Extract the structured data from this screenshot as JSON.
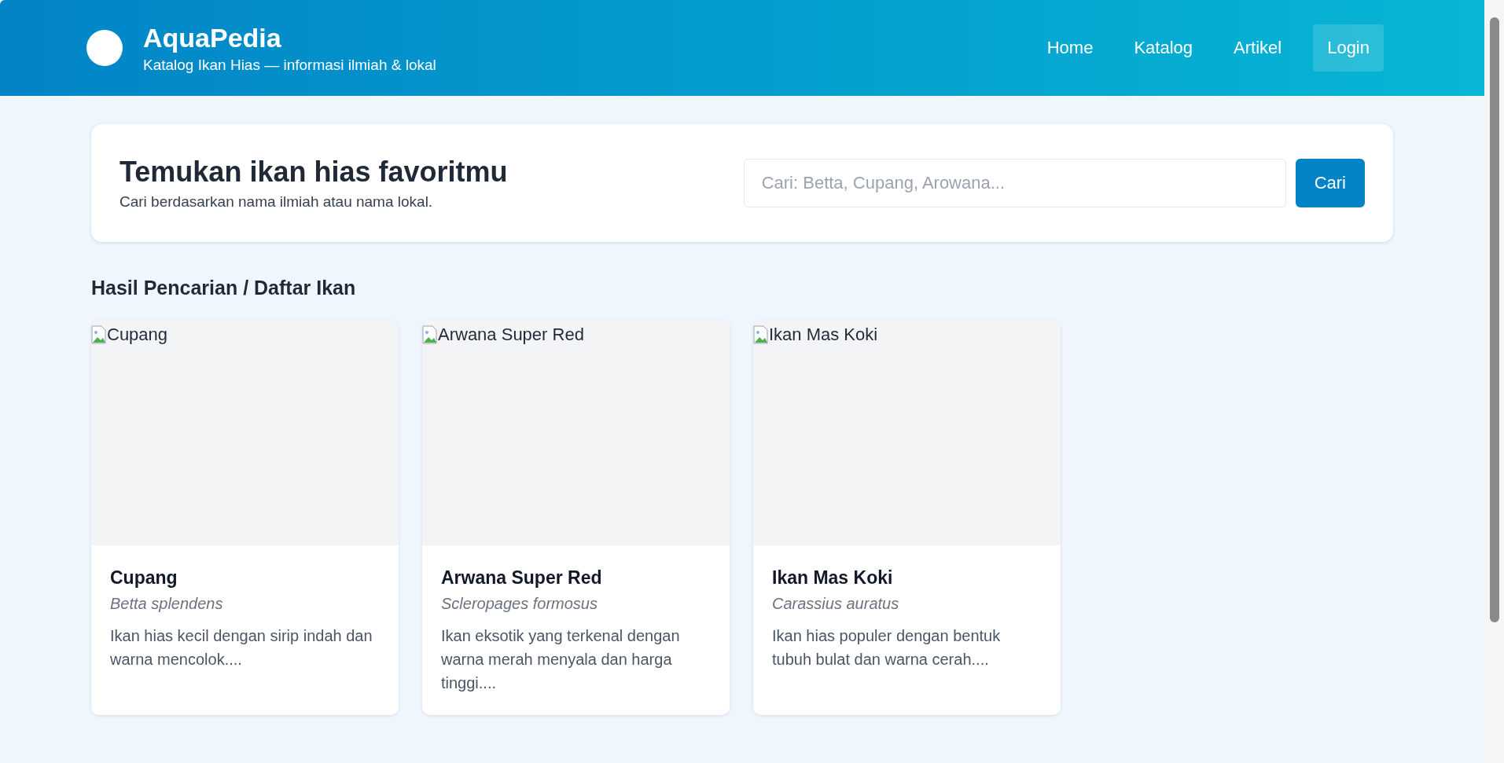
{
  "header": {
    "title": "AquaPedia",
    "subtitle": "Katalog Ikan Hias — informasi ilmiah & lokal",
    "nav": [
      {
        "label": "Home",
        "kind": "link"
      },
      {
        "label": "Katalog",
        "kind": "link"
      },
      {
        "label": "Artikel",
        "kind": "link"
      },
      {
        "label": "Login",
        "kind": "button"
      }
    ]
  },
  "search_card": {
    "title": "Temukan ikan hias favoritmu",
    "subtitle": "Cari berdasarkan nama ilmiah atau nama lokal.",
    "search": {
      "placeholder": "Cari: Betta, Cupang, Arowana..."
    },
    "button": "Cari"
  },
  "section_title": "Hasil Pencarian / Daftar Ikan",
  "fish": [
    {
      "image_alt": "Cupang",
      "name": "Cupang",
      "scientific_name": "Betta splendens",
      "description": "Ikan hias kecil dengan sirip indah dan warna mencolok...."
    },
    {
      "image_alt": "Arwana Super Red",
      "name": "Arwana Super Red",
      "scientific_name": "Scleropages formosus",
      "description": "Ikan eksotik yang terkenal dengan warna merah menyala dan harga tinggi...."
    },
    {
      "image_alt": "Ikan Mas Koki",
      "name": "Ikan Mas Koki",
      "scientific_name": "Carassius auratus",
      "description": "Ikan hias populer dengan bentuk tubuh bulat dan warna cerah...."
    }
  ]
}
